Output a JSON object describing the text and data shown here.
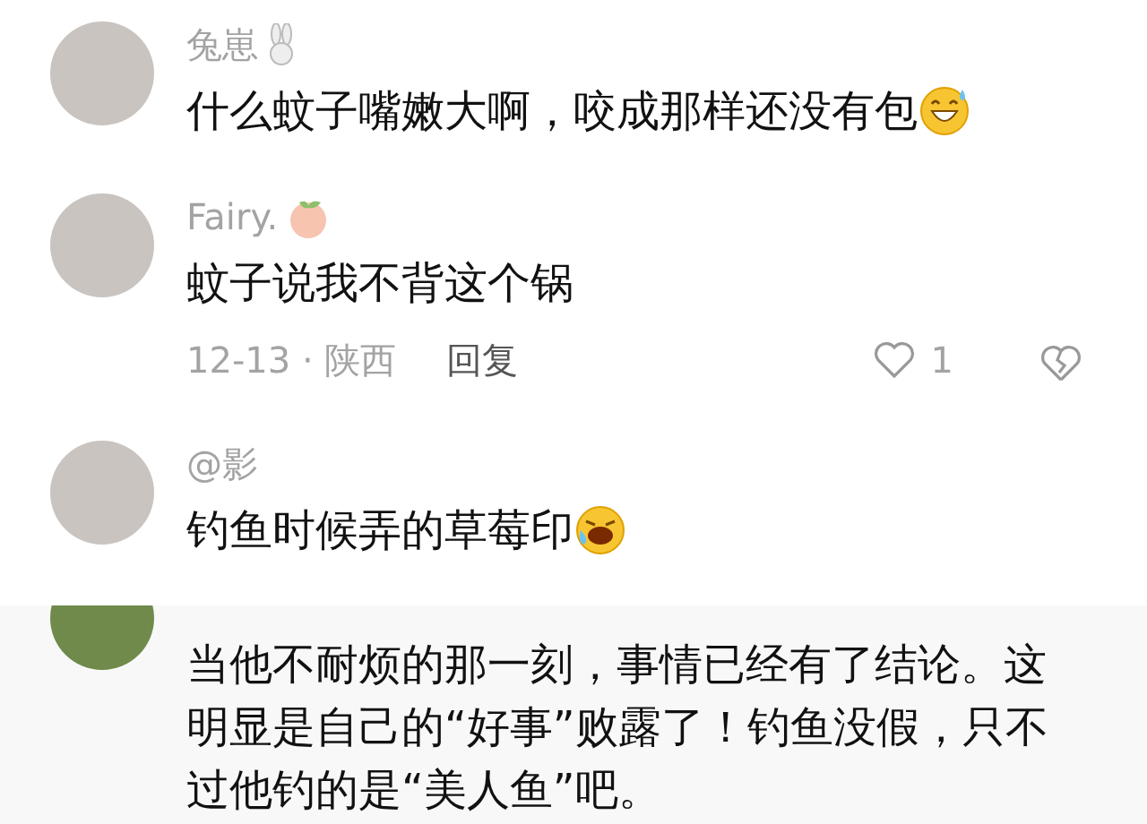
{
  "comments": [
    {
      "username": "兔崽",
      "badge": true,
      "text": "什么蚊子嘴嫩大啊，咬成那样还没有包",
      "emoji": true
    },
    {
      "username": "Fairy.",
      "badge": true,
      "text": "蚊子说我不背这个锅",
      "emoji": false,
      "meta": {
        "date_location": "12-13 · 陕西",
        "reply": "回复",
        "likes": "1"
      }
    },
    {
      "username": "@影",
      "badge": false,
      "text": "钓鱼时候弄的草莓印",
      "emoji": true
    }
  ],
  "clipped_comment": {
    "text": "当他不耐烦的那一刻，事情已经有了结论。这明显是自己的“好事”败露了！钓鱼没假，只不过他钓的是“美人鱼”吧。"
  }
}
